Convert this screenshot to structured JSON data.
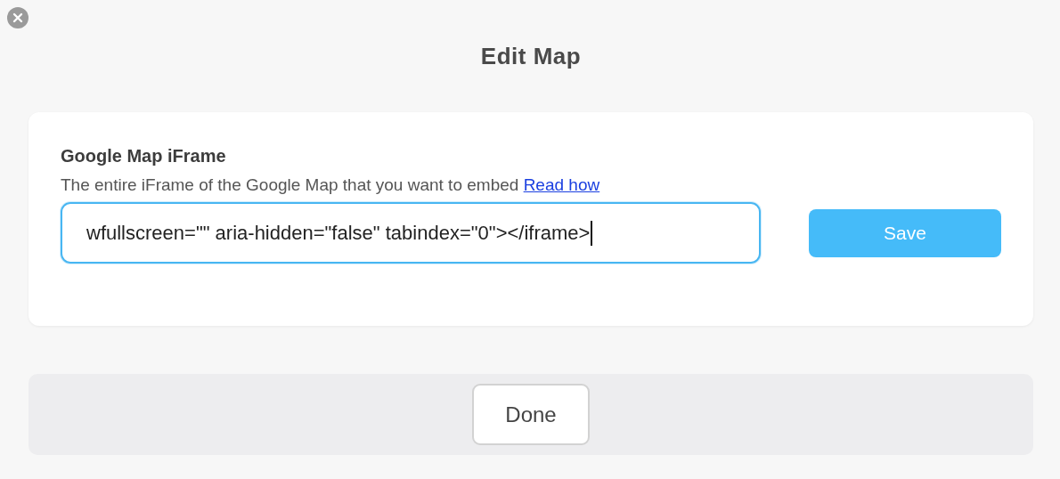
{
  "dialog": {
    "title": "Edit Map"
  },
  "card": {
    "label": "Google Map iFrame",
    "description": "The entire iFrame of the Google Map that you want to embed",
    "link": "Read how",
    "field": {
      "value": "wfullscreen=\"\" aria-hidden=\"false\" tabindex=\"0\"></iframe>",
      "focused": true
    },
    "save_button": "Save"
  },
  "footer": {
    "done_button": "Done"
  }
}
